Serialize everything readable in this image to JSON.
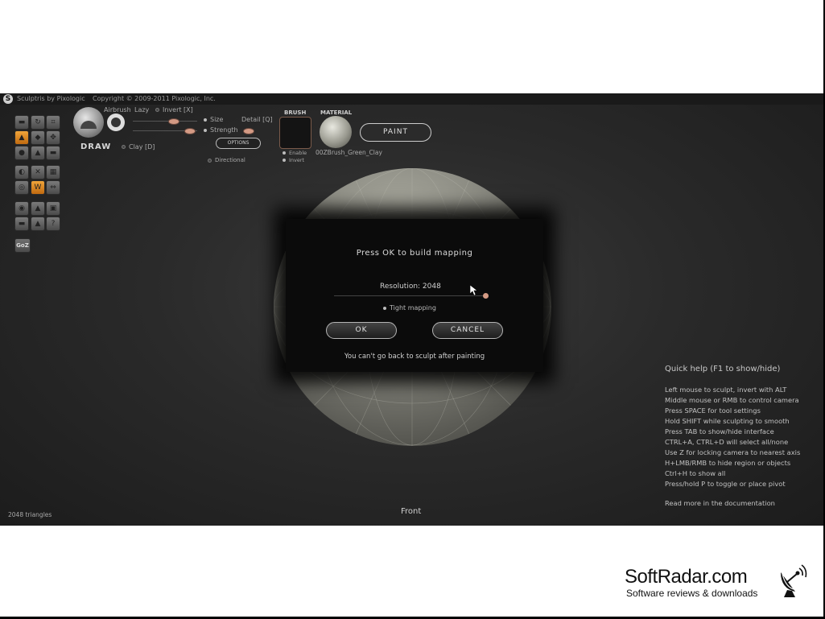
{
  "titlebar": {
    "app_name": "Sculptris by Pixologic",
    "copyright": "Copyright © 2009-2011 Pixologic, Inc."
  },
  "brush_panel": {
    "tool_name": "DRAW",
    "airbrush_label": "Airbrush",
    "lazy_label": "Lazy",
    "invert_label": "Invert [X]",
    "size_label": "Size",
    "detail_label": "Detail [Q]",
    "strength_label": "Strength",
    "options_label": "OPTIONS",
    "clay_label": "Clay [D]",
    "directional_label": "Directional",
    "brush_section": "BRUSH",
    "material_section": "MATERIAL",
    "enable_label": "Enable",
    "invert_small_label": "Invert",
    "material_name": "00ZBrush_Green_Clay",
    "paint_label": "PAINT"
  },
  "toolbar": {
    "goz_label": "GoZ"
  },
  "dialog": {
    "title": "Press OK to build mapping",
    "resolution_label": "Resolution: 2048",
    "resolution_value": 2048,
    "tight_mapping_label": "Tight mapping",
    "ok_label": "OK",
    "cancel_label": "CANCEL",
    "warning": "You can't go back to sculpt after painting"
  },
  "quick_help": {
    "title": "Quick help (F1 to show/hide)",
    "items": [
      "Left mouse to sculpt, invert with ALT",
      "Middle mouse or RMB to control camera",
      "Press SPACE for tool settings",
      "Hold SHIFT while sculpting to smooth",
      "Press TAB to show/hide interface",
      "CTRL+A, CTRL+D will select all/none",
      "Use Z for locking camera to nearest axis",
      "H+LMB/RMB to hide region or objects",
      "Ctrl+H to show all",
      "Press/hold P to toggle or place pivot"
    ],
    "read_more": "Read more in the documentation"
  },
  "status": {
    "triangles": "2048 triangles",
    "view": "Front"
  },
  "watermark": {
    "title": "SoftRadar.com",
    "subtitle": "Software reviews & downloads"
  },
  "colors": {
    "accent": "#f0a53a",
    "slider_knob": "#d49a84",
    "background": "#2a2a2a"
  }
}
